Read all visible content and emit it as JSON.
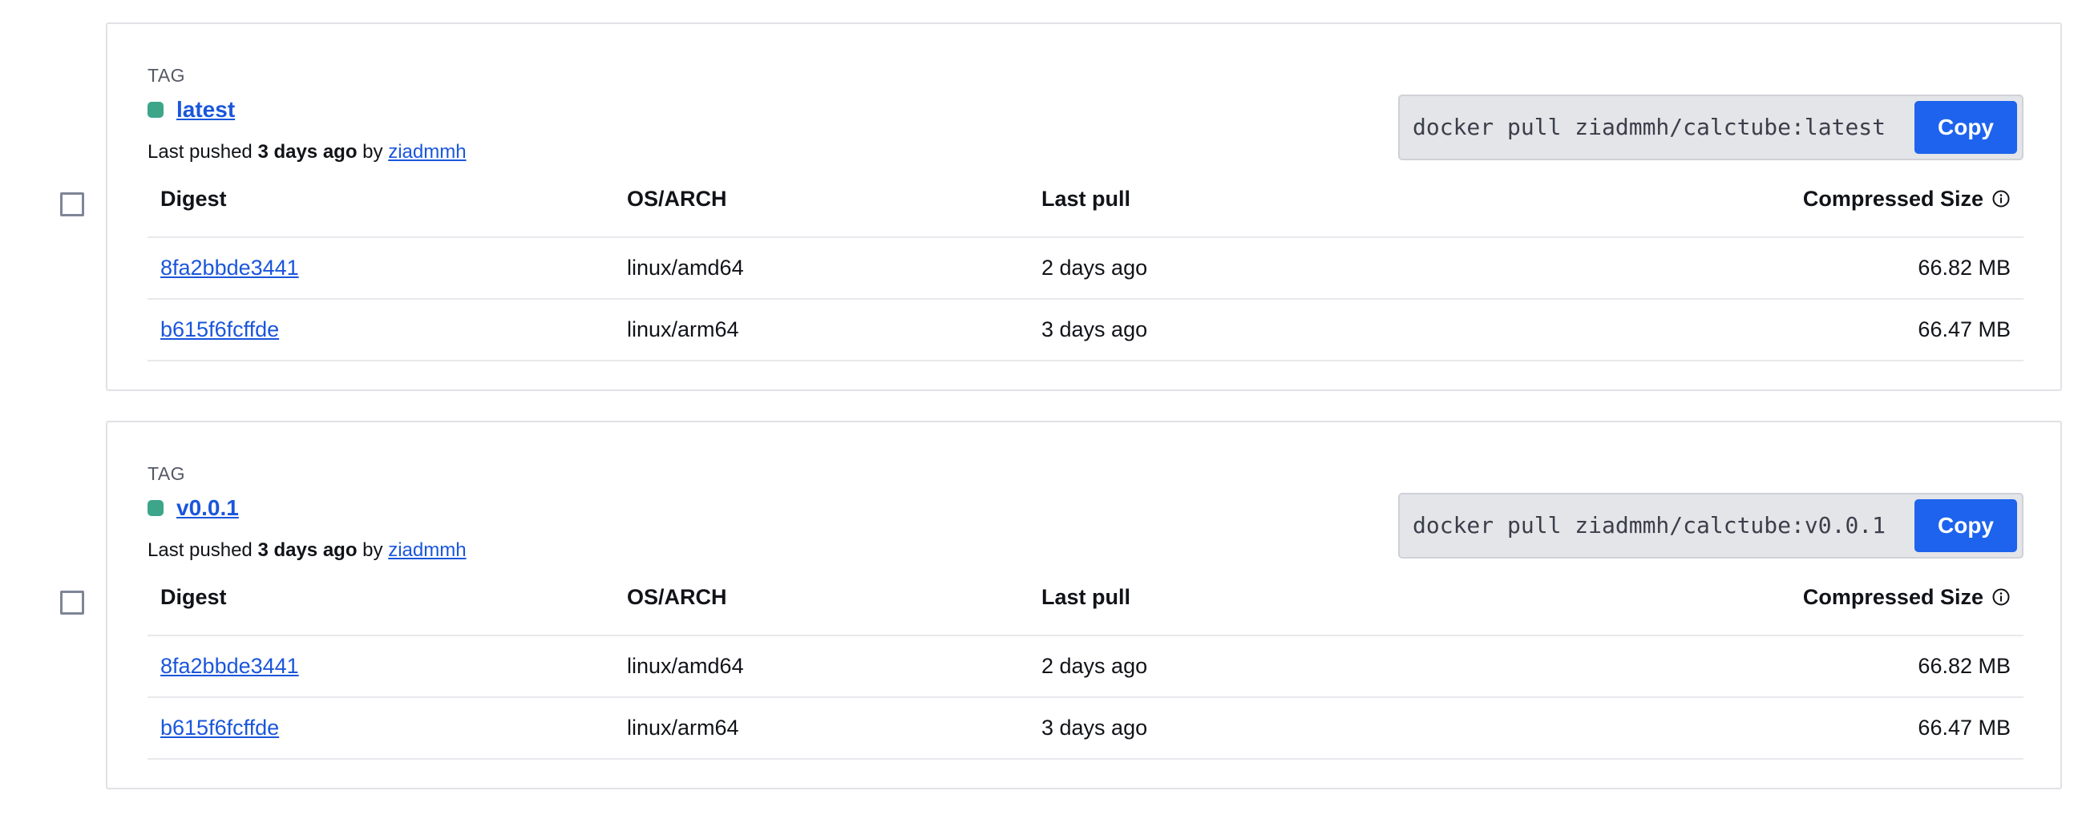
{
  "tags": [
    {
      "label": "TAG",
      "name": "latest",
      "pushed_prefix": "Last pushed ",
      "pushed_when": "3 days ago",
      "pushed_by_word": " by ",
      "pushed_user": "ziadmmh",
      "pull_command": "docker pull ziadmmh/calctube:latest",
      "copy_label": "Copy",
      "columns": {
        "digest": "Digest",
        "os_arch": "OS/ARCH",
        "last_pull": "Last pull",
        "compressed_size": "Compressed Size"
      },
      "rows": [
        {
          "digest": "8fa2bbde3441",
          "os_arch": "linux/amd64",
          "last_pull": "2 days ago",
          "size": "66.82 MB"
        },
        {
          "digest": "b615f6fcffde",
          "os_arch": "linux/arm64",
          "last_pull": "3 days ago",
          "size": "66.47 MB"
        }
      ]
    },
    {
      "label": "TAG",
      "name": "v0.0.1",
      "pushed_prefix": "Last pushed ",
      "pushed_when": "3 days ago",
      "pushed_by_word": " by ",
      "pushed_user": "ziadmmh",
      "pull_command": "docker pull ziadmmh/calctube:v0.0.1",
      "copy_label": "Copy",
      "columns": {
        "digest": "Digest",
        "os_arch": "OS/ARCH",
        "last_pull": "Last pull",
        "compressed_size": "Compressed Size"
      },
      "rows": [
        {
          "digest": "8fa2bbde3441",
          "os_arch": "linux/amd64",
          "last_pull": "2 days ago",
          "size": "66.82 MB"
        },
        {
          "digest": "b615f6fcffde",
          "os_arch": "linux/arm64",
          "last_pull": "3 days ago",
          "size": "66.47 MB"
        }
      ]
    }
  ],
  "colors": {
    "status_dot": "#3da58a",
    "link": "#1a56db",
    "copy_button": "#1d63ed"
  },
  "icons": {
    "info": "info-icon"
  }
}
